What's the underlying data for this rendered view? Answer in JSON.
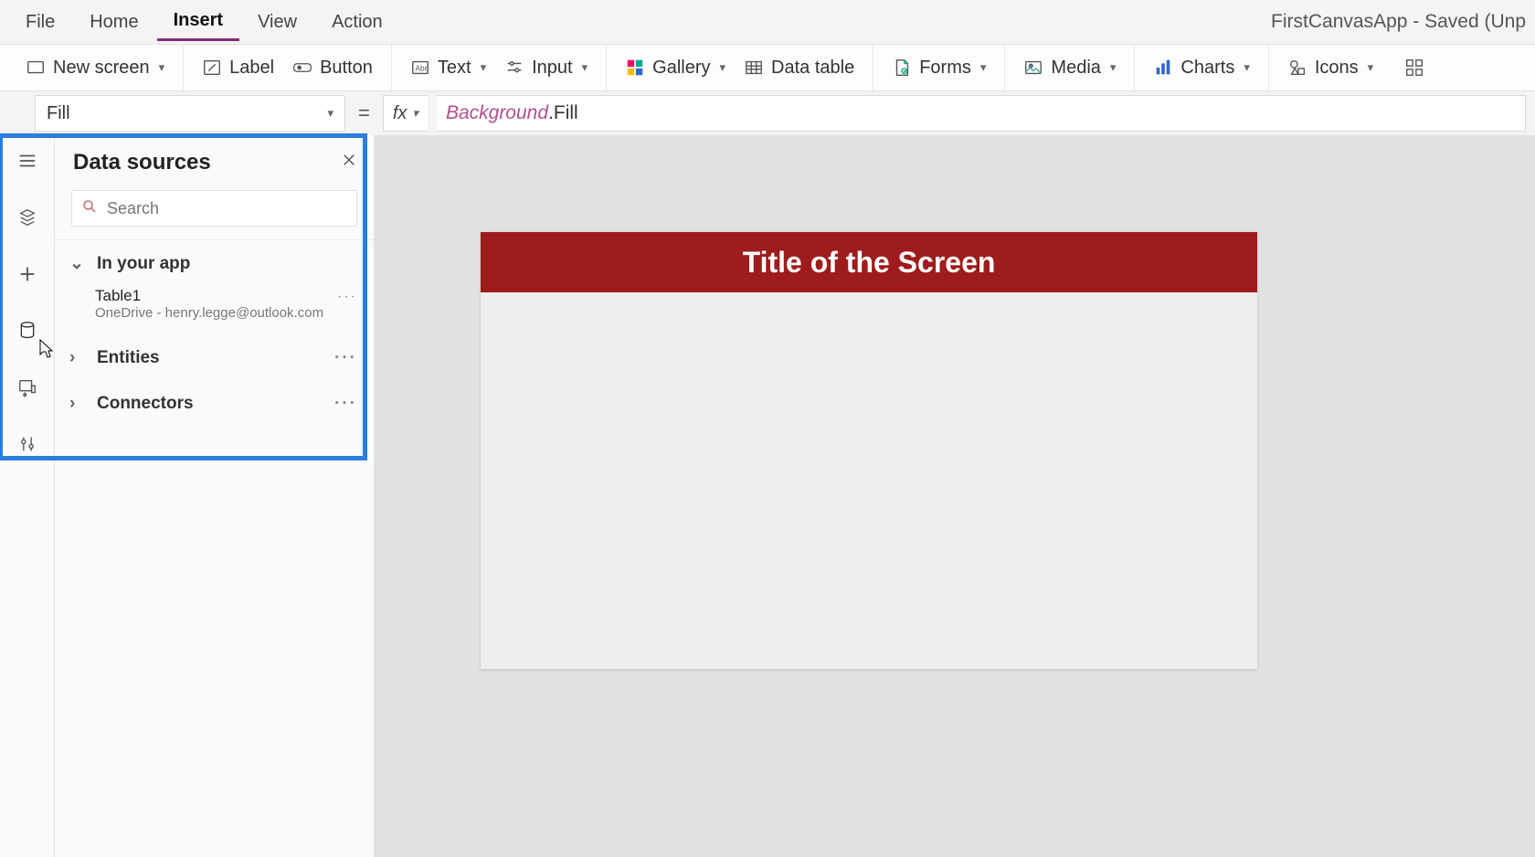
{
  "app_title": "FirstCanvasApp - Saved (Unp",
  "menu": {
    "file": "File",
    "home": "Home",
    "insert": "Insert",
    "view": "View",
    "action": "Action",
    "active": "insert"
  },
  "ribbon": {
    "new_screen": "New screen",
    "label": "Label",
    "button": "Button",
    "text": "Text",
    "input": "Input",
    "gallery": "Gallery",
    "data_table": "Data table",
    "forms": "Forms",
    "media": "Media",
    "charts": "Charts",
    "icons": "Icons"
  },
  "formula": {
    "property": "Fill",
    "fx_label": "fx",
    "token1": "Background",
    "token2": ".Fill"
  },
  "panel": {
    "title": "Data sources",
    "search_placeholder": "Search",
    "sections": {
      "in_your_app": {
        "label": "In your app"
      },
      "entities": {
        "label": "Entities"
      },
      "connectors": {
        "label": "Connectors"
      }
    },
    "sources": [
      {
        "name": "Table1",
        "detail": "OneDrive - henry.legge@outlook.com"
      }
    ]
  },
  "canvas": {
    "screen_title": "Title of the Screen"
  },
  "glyph": {
    "more": "···"
  }
}
